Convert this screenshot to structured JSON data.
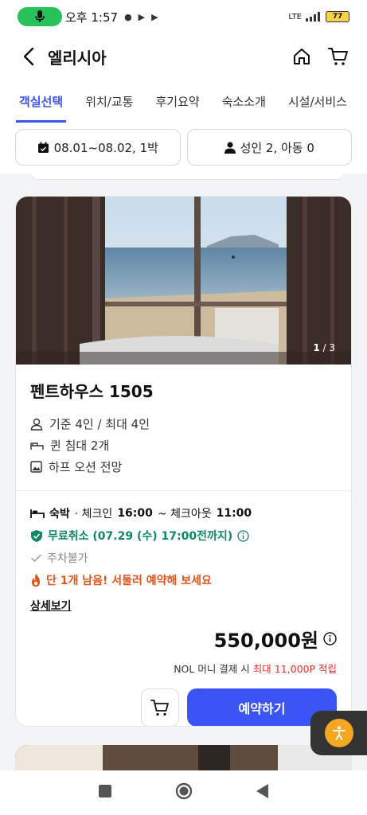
{
  "status_bar": {
    "time": "오후 1:57",
    "battery": "77",
    "network": "LTE"
  },
  "header": {
    "title": "엘리시아"
  },
  "tabs": [
    "객실선택",
    "위치/교통",
    "후기요약",
    "숙소소개",
    "시설/서비스"
  ],
  "filters": {
    "dates": "08.01~08.02, 1박",
    "guests": "성인 2, 아동 0"
  },
  "room": {
    "photo_counter_current": "1",
    "photo_counter_total": "/ 3",
    "name": "펜트하우스 1505",
    "capacity": "기준 4인 / 최대 4인",
    "bed": "퀸 침대 2개",
    "view": "하프 오션 전망"
  },
  "rate": {
    "stay_type": "숙박",
    "checkin_label": "· 체크인",
    "checkin_time": "16:00",
    "checkout_label": "~ 체크아웃",
    "checkout_time": "11:00",
    "cancel": "무료취소 (07.29 (수) 17:00전까지)",
    "parking": "주차불가",
    "urgency": "단 1개 남음! 서둘러 예약해 보세요",
    "detail_link": "상세보기",
    "price": "550,000원",
    "points_prefix": "NOL 머니 결제 시",
    "points_highlight": "최대 11,000P 적립",
    "book_label": "예약하기"
  },
  "colors": {
    "accent": "#3e55f0",
    "green": "#0e8a5c",
    "orange": "#e2531a",
    "red": "#e52e2e"
  }
}
